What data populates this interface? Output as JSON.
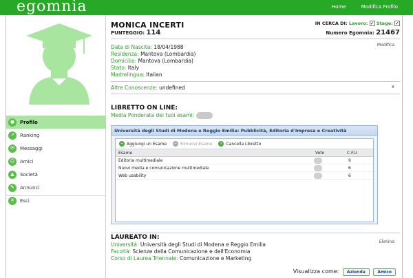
{
  "app": {
    "logo": "egomnia"
  },
  "topnav": {
    "home": "Home",
    "edit_profile": "Modifica Profilo"
  },
  "sidebar": {
    "items": [
      {
        "label": "Profilo",
        "icon": "person-icon",
        "active": true
      },
      {
        "label": "Ranking",
        "icon": "ranking-icon",
        "active": false
      },
      {
        "label": "Messaggi",
        "icon": "message-icon",
        "active": false
      },
      {
        "label": "Amici",
        "icon": "friends-icon",
        "active": false
      },
      {
        "label": "Società",
        "icon": "company-icon",
        "active": false
      },
      {
        "label": "Annunci",
        "icon": "announcements-icon",
        "active": false
      },
      {
        "label": "Esci",
        "icon": "exit-icon",
        "active": false
      }
    ]
  },
  "profile": {
    "name": "MONICA INCERTI",
    "score_label": "PUNTEGGIO:",
    "score": "114",
    "seeking_label": "IN CERCA DI:",
    "seeking_work_label": "Lavoro:",
    "seeking_work_checked": "✓",
    "seeking_stage_label": "Stage:",
    "seeking_stage_checked": "✓",
    "number_label": "Numero Egomnia:",
    "number": "21467",
    "edit_link": "Modifica",
    "details": [
      {
        "label": "Data di Nascita:",
        "value": "18/04/1988"
      },
      {
        "label": "Residenza:",
        "value": "Mantova (Lombardia)"
      },
      {
        "label": "Domicilio:",
        "value": "Mantova (Lombardia)"
      },
      {
        "label": "Stato:",
        "value": "Italy"
      },
      {
        "label": "Madrelingua:",
        "value": "Italian"
      }
    ],
    "other_knowledge_label": "Altre Conoscenze:",
    "other_knowledge_value": "undefined",
    "other_close": "x"
  },
  "libretto": {
    "title": "LIBRETTO ON LINE:",
    "weighted_avg_label": "Media Ponderata dei tuoi esami:",
    "panel_title": "Università degli Studi di Modena e Reggio Emilia: Pubblicità, Editoria d'Impresa e Creatività",
    "toolbar": {
      "add": "Aggiungi un Esame",
      "remove": "Rimuovi Esame",
      "delete": "Cancella Libretto"
    },
    "columns": {
      "exam": "Esame",
      "grade": "Voto",
      "cfu": "C.F.U"
    },
    "rows": [
      {
        "exam": "Editoria multimediale",
        "cfu": "9"
      },
      {
        "exam": "Nuovi media e comunicazione multimediale",
        "cfu": "6"
      },
      {
        "exam": "Web usability",
        "cfu": "6"
      }
    ]
  },
  "graduated": {
    "title": "LAUREATO IN:",
    "delete_link": "Elimina",
    "details": [
      {
        "label": "Università:",
        "value": "Università degli Studi di Modena e Reggio Emilia"
      },
      {
        "label": "Facoltà:",
        "value": "Scienze della Comunicazione e dell'Economia"
      },
      {
        "label": "Corso di Laurea Triennale:",
        "value": "Comunicazione e Marketing"
      }
    ]
  },
  "view_as": {
    "label": "Visualizza come:",
    "company": "Azienda",
    "friend": "Amico"
  },
  "colors": {
    "brand_green": "#27a827",
    "label_green": "#2d9a2d",
    "active_menu": "#a8e6a0",
    "panel_blue": "#9ab6d6"
  }
}
